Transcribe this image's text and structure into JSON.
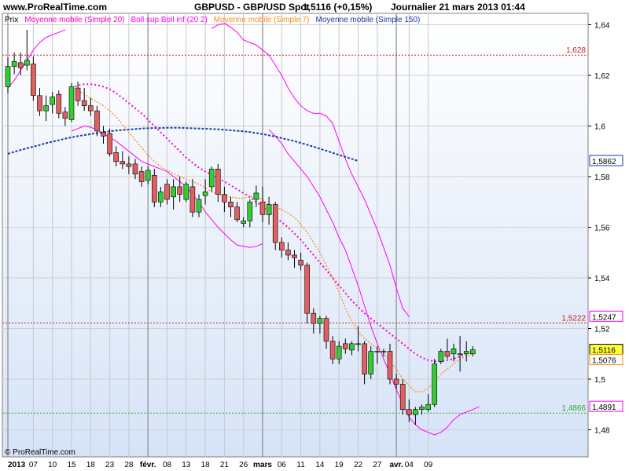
{
  "header": {
    "site": "www.ProRealTime.com",
    "instrument": "GBPUSD - GBP/USD Spot",
    "last": "1,5116 (+0,15%)",
    "period": "Journalier  21 mars 2013 01:44"
  },
  "footer": {
    "copyright": "© ProRealTime.com"
  },
  "colors": {
    "up": "#33cc33",
    "down": "#e06060",
    "sma20": "#ff00cc",
    "boll": "#ff00ff",
    "sma7": "#ff8c1a",
    "sma150": "#1a3aaa",
    "ref_red": "#cc2222",
    "ref_green": "#33aa33",
    "grid": "#c0c0c0"
  },
  "chart_data": {
    "type": "candlestick",
    "legend": [
      {
        "label": "Prix",
        "color": "#000000"
      },
      {
        "label": "Moyenne mobile (Simple 20)",
        "color": "#ff00cc"
      },
      {
        "label": "Boll sup Boll inf (20 2)",
        "color": "#ff00ff"
      },
      {
        "label": "Moyenne mobile (Simple 7)",
        "color": "#ff8c1a"
      },
      {
        "label": "Moyenne mobile (Simple 150)",
        "color": "#1a3aaa"
      }
    ],
    "ylim": [
      1.47,
      1.65
    ],
    "y_ticks": [
      "1,48",
      "1,5",
      "1,52",
      "1,54",
      "1,56",
      "1,58",
      "1,6",
      "1,62",
      "1,64"
    ],
    "y_tick_values": [
      1.48,
      1.5,
      1.52,
      1.54,
      1.56,
      1.58,
      1.6,
      1.62,
      1.64
    ],
    "x_labels": [
      "2013",
      "07",
      "10",
      "15",
      "18",
      "23",
      "28",
      "févr.",
      "08",
      "13",
      "18",
      "21",
      "26",
      "mars",
      "06",
      "11",
      "14",
      "19",
      "22",
      "27",
      "avr.",
      "04",
      "09"
    ],
    "x_label_index": [
      0,
      4,
      7,
      10,
      13,
      16,
      19,
      22,
      25,
      28,
      31,
      34,
      37,
      40,
      43,
      46,
      49,
      52,
      55,
      58,
      61,
      63,
      66
    ],
    "month_start_index": [
      0,
      22,
      40,
      61
    ],
    "candles": [
      {
        "o": 1.6155,
        "h": 1.627,
        "l": 1.613,
        "c": 1.6235
      },
      {
        "o": 1.6235,
        "h": 1.629,
        "l": 1.6205,
        "c": 1.6255
      },
      {
        "o": 1.625,
        "h": 1.629,
        "l": 1.62,
        "c": 1.623
      },
      {
        "o": 1.624,
        "h": 1.638,
        "l": 1.622,
        "c": 1.626
      },
      {
        "o": 1.6245,
        "h": 1.6275,
        "l": 1.61,
        "c": 1.612
      },
      {
        "o": 1.612,
        "h": 1.615,
        "l": 1.604,
        "c": 1.606
      },
      {
        "o": 1.606,
        "h": 1.612,
        "l": 1.602,
        "c": 1.608
      },
      {
        "o": 1.6085,
        "h": 1.6135,
        "l": 1.605,
        "c": 1.6115
      },
      {
        "o": 1.6125,
        "h": 1.614,
        "l": 1.603,
        "c": 1.605
      },
      {
        "o": 1.6055,
        "h": 1.6075,
        "l": 1.6,
        "c": 1.603
      },
      {
        "o": 1.6025,
        "h": 1.617,
        "l": 1.6015,
        "c": 1.6155
      },
      {
        "o": 1.615,
        "h": 1.6175,
        "l": 1.608,
        "c": 1.61
      },
      {
        "o": 1.61,
        "h": 1.615,
        "l": 1.606,
        "c": 1.608
      },
      {
        "o": 1.608,
        "h": 1.611,
        "l": 1.604,
        "c": 1.606
      },
      {
        "o": 1.606,
        "h": 1.608,
        "l": 1.596,
        "c": 1.598
      },
      {
        "o": 1.5975,
        "h": 1.6,
        "l": 1.593,
        "c": 1.596
      },
      {
        "o": 1.597,
        "h": 1.599,
        "l": 1.588,
        "c": 1.589
      },
      {
        "o": 1.5895,
        "h": 1.592,
        "l": 1.584,
        "c": 1.586
      },
      {
        "o": 1.586,
        "h": 1.59,
        "l": 1.583,
        "c": 1.585
      },
      {
        "o": 1.585,
        "h": 1.588,
        "l": 1.581,
        "c": 1.584
      },
      {
        "o": 1.585,
        "h": 1.587,
        "l": 1.579,
        "c": 1.581
      },
      {
        "o": 1.582,
        "h": 1.584,
        "l": 1.576,
        "c": 1.578
      },
      {
        "o": 1.5785,
        "h": 1.584,
        "l": 1.577,
        "c": 1.5825
      },
      {
        "o": 1.5805,
        "h": 1.583,
        "l": 1.568,
        "c": 1.57
      },
      {
        "o": 1.57,
        "h": 1.576,
        "l": 1.568,
        "c": 1.574
      },
      {
        "o": 1.577,
        "h": 1.579,
        "l": 1.569,
        "c": 1.571
      },
      {
        "o": 1.572,
        "h": 1.579,
        "l": 1.567,
        "c": 1.576
      },
      {
        "o": 1.576,
        "h": 1.58,
        "l": 1.57,
        "c": 1.573
      },
      {
        "o": 1.571,
        "h": 1.578,
        "l": 1.57,
        "c": 1.577
      },
      {
        "o": 1.576,
        "h": 1.579,
        "l": 1.564,
        "c": 1.566
      },
      {
        "o": 1.566,
        "h": 1.573,
        "l": 1.564,
        "c": 1.571
      },
      {
        "o": 1.5725,
        "h": 1.579,
        "l": 1.569,
        "c": 1.574
      },
      {
        "o": 1.576,
        "h": 1.584,
        "l": 1.574,
        "c": 1.583
      },
      {
        "o": 1.583,
        "h": 1.585,
        "l": 1.57,
        "c": 1.573
      },
      {
        "o": 1.573,
        "h": 1.576,
        "l": 1.566,
        "c": 1.57
      },
      {
        "o": 1.57,
        "h": 1.572,
        "l": 1.564,
        "c": 1.568
      },
      {
        "o": 1.568,
        "h": 1.57,
        "l": 1.562,
        "c": 1.563
      },
      {
        "o": 1.5615,
        "h": 1.564,
        "l": 1.56,
        "c": 1.5625
      },
      {
        "o": 1.5625,
        "h": 1.571,
        "l": 1.56,
        "c": 1.57
      },
      {
        "o": 1.571,
        "h": 1.5765,
        "l": 1.568,
        "c": 1.5735
      },
      {
        "o": 1.57,
        "h": 1.576,
        "l": 1.562,
        "c": 1.565
      },
      {
        "o": 1.565,
        "h": 1.572,
        "l": 1.561,
        "c": 1.569
      },
      {
        "o": 1.569,
        "h": 1.57,
        "l": 1.551,
        "c": 1.554
      },
      {
        "o": 1.554,
        "h": 1.556,
        "l": 1.548,
        "c": 1.551
      },
      {
        "o": 1.551,
        "h": 1.554,
        "l": 1.547,
        "c": 1.549
      },
      {
        "o": 1.549,
        "h": 1.551,
        "l": 1.544,
        "c": 1.548
      },
      {
        "o": 1.547,
        "h": 1.55,
        "l": 1.543,
        "c": 1.545
      },
      {
        "o": 1.545,
        "h": 1.546,
        "l": 1.522,
        "c": 1.526
      },
      {
        "o": 1.526,
        "h": 1.528,
        "l": 1.518,
        "c": 1.522
      },
      {
        "o": 1.522,
        "h": 1.525,
        "l": 1.518,
        "c": 1.524
      },
      {
        "o": 1.524,
        "h": 1.525,
        "l": 1.512,
        "c": 1.515
      },
      {
        "o": 1.515,
        "h": 1.517,
        "l": 1.506,
        "c": 1.508
      },
      {
        "o": 1.508,
        "h": 1.515,
        "l": 1.506,
        "c": 1.513
      },
      {
        "o": 1.514,
        "h": 1.516,
        "l": 1.51,
        "c": 1.512
      },
      {
        "o": 1.5115,
        "h": 1.515,
        "l": 1.5095,
        "c": 1.514
      },
      {
        "o": 1.514,
        "h": 1.521,
        "l": 1.511,
        "c": 1.514
      },
      {
        "o": 1.514,
        "h": 1.515,
        "l": 1.498,
        "c": 1.502
      },
      {
        "o": 1.502,
        "h": 1.513,
        "l": 1.5,
        "c": 1.511
      },
      {
        "o": 1.511,
        "h": 1.513,
        "l": 1.506,
        "c": 1.511
      },
      {
        "o": 1.511,
        "h": 1.512,
        "l": 1.509,
        "c": 1.511
      },
      {
        "o": 1.511,
        "h": 1.514,
        "l": 1.498,
        "c": 1.5
      },
      {
        "o": 1.5,
        "h": 1.502,
        "l": 1.496,
        "c": 1.498
      },
      {
        "o": 1.498,
        "h": 1.5,
        "l": 1.486,
        "c": 1.488
      },
      {
        "o": 1.488,
        "h": 1.492,
        "l": 1.483,
        "c": 1.486
      },
      {
        "o": 1.486,
        "h": 1.489,
        "l": 1.482,
        "c": 1.488
      },
      {
        "o": 1.488,
        "h": 1.49,
        "l": 1.486,
        "c": 1.489
      },
      {
        "o": 1.488,
        "h": 1.494,
        "l": 1.487,
        "c": 1.49
      },
      {
        "o": 1.49,
        "h": 1.508,
        "l": 1.489,
        "c": 1.506
      },
      {
        "o": 1.507,
        "h": 1.512,
        "l": 1.506,
        "c": 1.511
      },
      {
        "o": 1.511,
        "h": 1.516,
        "l": 1.508,
        "c": 1.509
      },
      {
        "o": 1.51,
        "h": 1.514,
        "l": 1.507,
        "c": 1.512
      },
      {
        "o": 1.51,
        "h": 1.517,
        "l": 1.503,
        "c": 1.51
      },
      {
        "o": 1.51,
        "h": 1.515,
        "l": 1.507,
        "c": 1.511
      },
      {
        "o": 1.51,
        "h": 1.513,
        "l": 1.509,
        "c": 1.5116
      }
    ],
    "sma20": [
      1.615,
      1.616,
      1.6165,
      1.6165,
      1.6162,
      1.6155,
      1.6145,
      1.613,
      1.611,
      1.609,
      1.607,
      1.605,
      1.6025,
      1.6,
      1.5975,
      1.595,
      1.5925,
      1.59,
      1.5875,
      1.5855,
      1.5835,
      1.582,
      1.5808,
      1.5795,
      1.578,
      1.5765,
      1.575,
      1.5735,
      1.572,
      1.57,
      1.568,
      1.566,
      1.564,
      1.562,
      1.56,
      1.5575,
      1.555,
      1.552,
      1.549,
      1.546,
      1.543,
      1.54,
      1.537,
      1.534,
      1.531,
      1.5285,
      1.526,
      1.524,
      1.522,
      1.52,
      1.518,
      1.516,
      1.514,
      1.512,
      1.51,
      1.5085,
      1.5075,
      1.507,
      1.507,
      1.5075,
      1.508,
      1.509,
      1.51
    ],
    "sma20_start": 10,
    "sma7": [
      1.614,
      1.6125,
      1.611,
      1.6095,
      1.608,
      1.606,
      1.6035,
      1.6005,
      1.5975,
      1.5945,
      1.5915,
      1.5885,
      1.586,
      1.584,
      1.5825,
      1.5812,
      1.58,
      1.579,
      1.578,
      1.577,
      1.5755,
      1.574,
      1.573,
      1.5725,
      1.572,
      1.5715,
      1.5715,
      1.572,
      1.572,
      1.571,
      1.569,
      1.568,
      1.567,
      1.5655,
      1.564,
      1.561,
      1.558,
      1.554,
      1.55,
      1.545,
      1.54,
      1.5345,
      1.528,
      1.523,
      1.519,
      1.516,
      1.514,
      1.512,
      1.51,
      1.507,
      1.504,
      1.5,
      1.4975,
      1.495,
      1.495,
      1.4965,
      1.499,
      1.502,
      1.504,
      1.506,
      1.508,
      1.509,
      1.51
    ],
    "sma7_start": 11,
    "boll_upper": [
      1.6385,
      1.64,
      1.6405,
      1.639,
      1.637,
      1.634,
      1.633,
      1.632,
      1.63,
      1.628,
      1.624,
      1.62,
      1.615,
      1.611,
      1.608,
      1.606,
      1.605,
      1.605,
      1.604,
      1.601,
      1.594,
      1.587,
      1.581,
      1.576,
      1.571,
      1.565,
      1.559,
      1.552,
      1.545,
      1.536,
      1.528,
      1.5247
    ],
    "boll_upper_start": 32,
    "boll_upper_lead": [
      1.615,
      1.618,
      1.622,
      1.626,
      1.63,
      1.633,
      1.635,
      1.636,
      1.637,
      1.638
    ],
    "boll_lower": [
      1.5985,
      1.596,
      1.593,
      1.589,
      1.586,
      1.583,
      1.58,
      1.576,
      1.572,
      1.567,
      1.562,
      1.556,
      1.551,
      1.544,
      1.537,
      1.529,
      1.521,
      1.514,
      1.508,
      1.502,
      1.496,
      1.49,
      1.485,
      1.482,
      1.48,
      1.479,
      1.478,
      1.479,
      1.481,
      1.484,
      1.486,
      1.487,
      1.488,
      1.4891
    ],
    "boll_lower_start": 41,
    "boll_lower_lead": [
      1.598,
      1.599,
      1.6,
      1.5995,
      1.5985,
      1.597,
      1.5955,
      1.594,
      1.592,
      1.59,
      1.588,
      1.586,
      1.585,
      1.584,
      1.583,
      1.582,
      1.58,
      1.578,
      1.576,
      1.573,
      1.57,
      1.566,
      1.563,
      1.56,
      1.5575,
      1.555,
      1.553,
      1.5525,
      1.552,
      1.5525,
      1.5535
    ],
    "sma150": [
      1.589,
      1.5898,
      1.5905,
      1.5912,
      1.5918,
      1.5925,
      1.5932,
      1.5938,
      1.5944,
      1.595,
      1.5955,
      1.596,
      1.5964,
      1.5968,
      1.5972,
      1.5976,
      1.5979,
      1.5982,
      1.5984,
      1.5986,
      1.5988,
      1.599,
      1.5991,
      1.5992,
      1.5992,
      1.5993,
      1.5993,
      1.5993,
      1.5992,
      1.5991,
      1.599,
      1.5989,
      1.5988,
      1.5987,
      1.5985,
      1.5983,
      1.5981,
      1.5979,
      1.5976,
      1.5972,
      1.5968,
      1.5963,
      1.5958,
      1.5952,
      1.5946,
      1.594,
      1.5933,
      1.5926,
      1.5918,
      1.591,
      1.5902,
      1.5894,
      1.5886,
      1.5878,
      1.587,
      1.5862
    ],
    "sma150_start": 0,
    "reference_lines": [
      {
        "value": 1.628,
        "label": "1,628",
        "color": "#cc2222",
        "style": "dotted"
      },
      {
        "value": 1.5222,
        "label": "1,5222",
        "color": "#cc2222",
        "style": "dotted"
      },
      {
        "value": 1.4866,
        "label": "1,4866",
        "color": "#33aa33",
        "style": "dotted"
      }
    ],
    "price_tags": [
      {
        "value": 1.5862,
        "label": "1,5862",
        "color": "#1a3aaa",
        "bg": "#ffffff"
      },
      {
        "value": 1.5247,
        "label": "1,5247",
        "color": "#ff00ff",
        "bg": "#ffffff"
      },
      {
        "value": 1.5116,
        "label": "1,5116",
        "color": "#000000",
        "bg": "#ffff33"
      },
      {
        "value": 1.5076,
        "label": "1,5076",
        "color": "#ff8c1a",
        "bg": "#ffffff"
      },
      {
        "value": 1.4891,
        "label": "1,4891",
        "color": "#ff00ff",
        "bg": "#ffffff"
      }
    ]
  }
}
